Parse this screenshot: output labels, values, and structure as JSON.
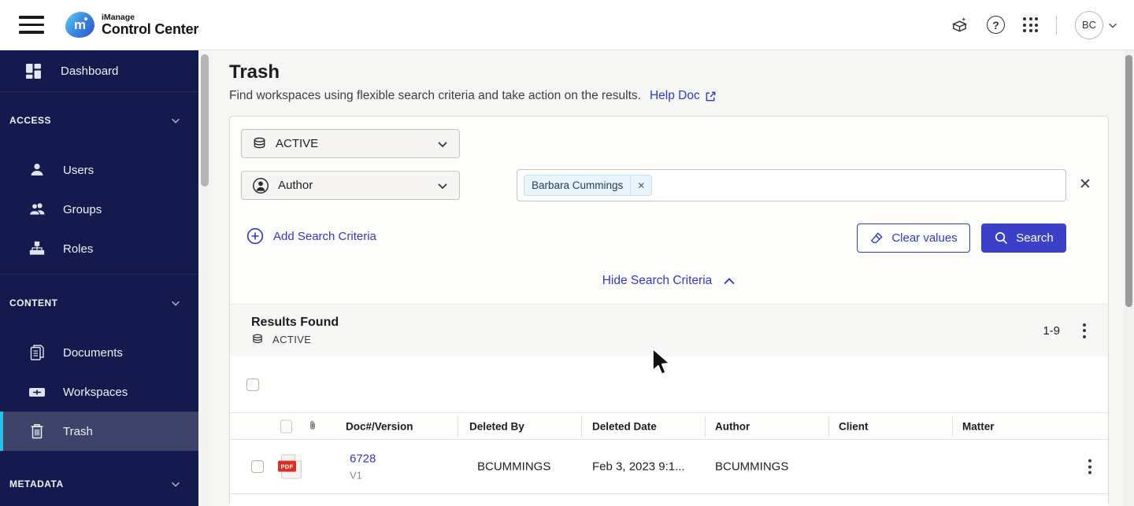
{
  "topbar": {
    "brand_top": "iManage",
    "brand_bottom": "Control Center",
    "avatar": "BC"
  },
  "sidebar": {
    "dashboard": "Dashboard",
    "access": {
      "label": "ACCESS",
      "items": [
        "Users",
        "Groups",
        "Roles"
      ]
    },
    "content": {
      "label": "CONTENT",
      "items": [
        "Documents",
        "Workspaces",
        "Trash"
      ]
    },
    "metadata": {
      "label": "METADATA"
    }
  },
  "page": {
    "title": "Trash",
    "subtitle": "Find workspaces using flexible search criteria and take action on the results.",
    "help_link": "Help Doc"
  },
  "search": {
    "repo_value": "ACTIVE",
    "field_value": "Author",
    "chip": "Barbara Cummings",
    "add_label": "Add Search Criteria",
    "clear_label": "Clear values",
    "search_label": "Search",
    "hide_label": "Hide Search Criteria"
  },
  "results": {
    "title": "Results Found",
    "repo": "ACTIVE",
    "range": "1-9",
    "columns": [
      "Doc#/Version",
      "Deleted By",
      "Deleted Date",
      "Author",
      "Client",
      "Matter"
    ],
    "rows": [
      {
        "doc": "6728",
        "version": "V1",
        "file_type": "PDF",
        "deleted_by": "BCUMMINGS",
        "deleted_date": "Feb 3, 2023 9:1...",
        "author": "BCUMMINGS",
        "client": "",
        "matter": ""
      }
    ]
  },
  "colors": {
    "accent": "#3138c7",
    "btn": "#3a40c8",
    "navy": "#151a4e",
    "navy-sel": "#3e4369",
    "cyan": "#27c3ea",
    "bg": "#f6f6f4"
  }
}
